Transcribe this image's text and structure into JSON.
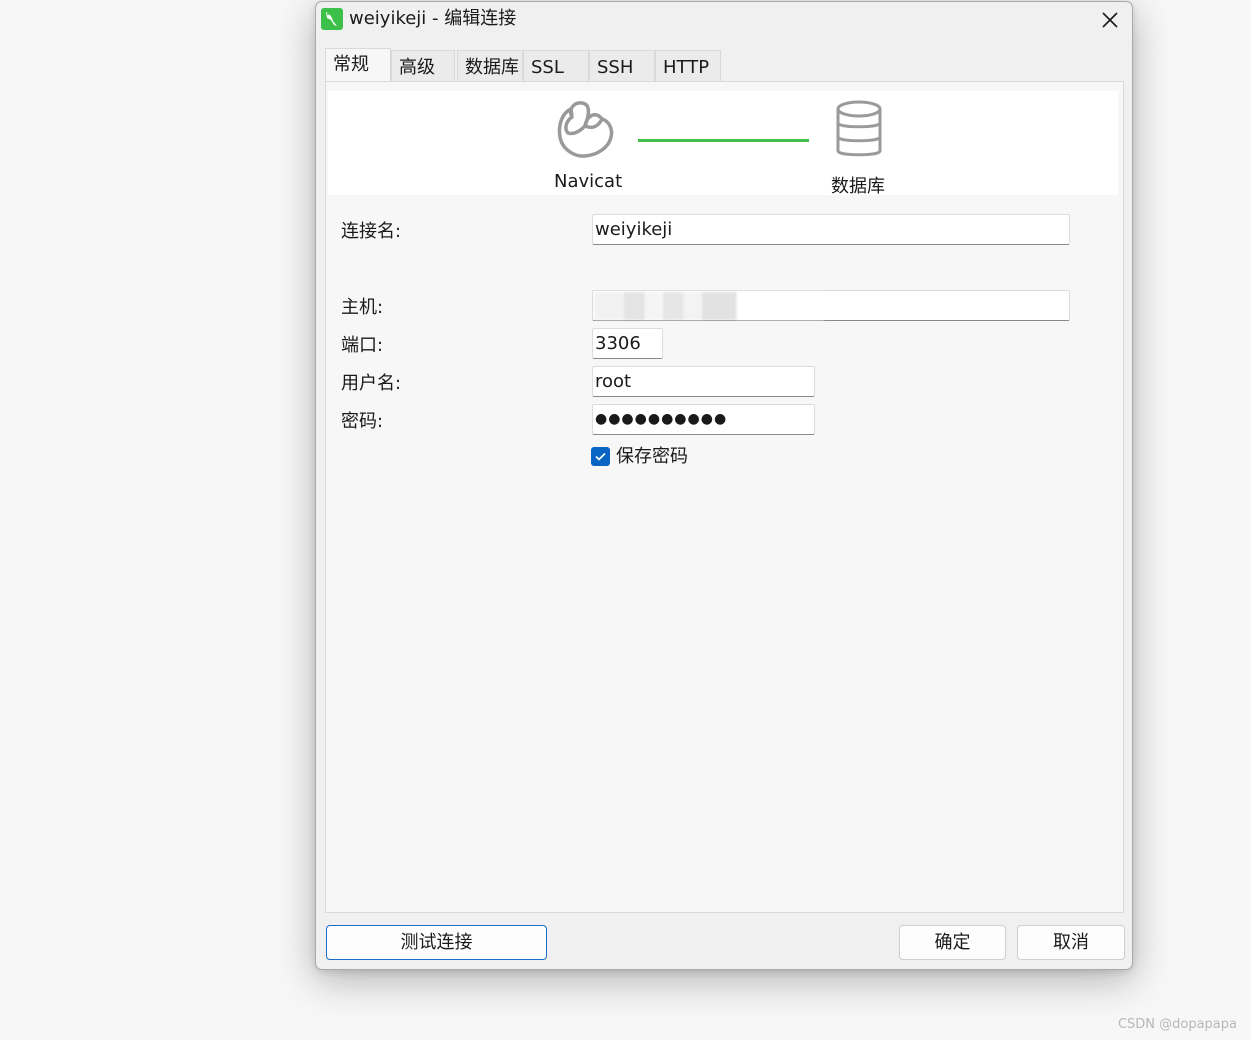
{
  "window": {
    "title": "weiyikeji - 编辑连接"
  },
  "tabs": [
    {
      "label": "常规",
      "active": true
    },
    {
      "label": "高级",
      "active": false
    },
    {
      "label": "数据库",
      "active": false
    },
    {
      "label": "SSL",
      "active": false
    },
    {
      "label": "SSH",
      "active": false
    },
    {
      "label": "HTTP",
      "active": false
    }
  ],
  "diagram": {
    "left_label": "Navicat",
    "right_label": "数据库",
    "line_color": "#43c04a"
  },
  "form": {
    "connection_name": {
      "label": "连接名:",
      "value": "weiyikeji"
    },
    "host": {
      "label": "主机:",
      "value": ""
    },
    "port": {
      "label": "端口:",
      "value": "3306"
    },
    "username": {
      "label": "用户名:",
      "value": "root"
    },
    "password": {
      "label": "密码:",
      "value": "●●●●●●●●●●"
    },
    "save_password": {
      "label": "保存密码",
      "checked": true
    }
  },
  "buttons": {
    "test": "测试连接",
    "ok": "确定",
    "cancel": "取消"
  },
  "watermark": "CSDN @dopapapa",
  "colors": {
    "accent": "#0a64c4",
    "logo": "#3cc04a"
  }
}
